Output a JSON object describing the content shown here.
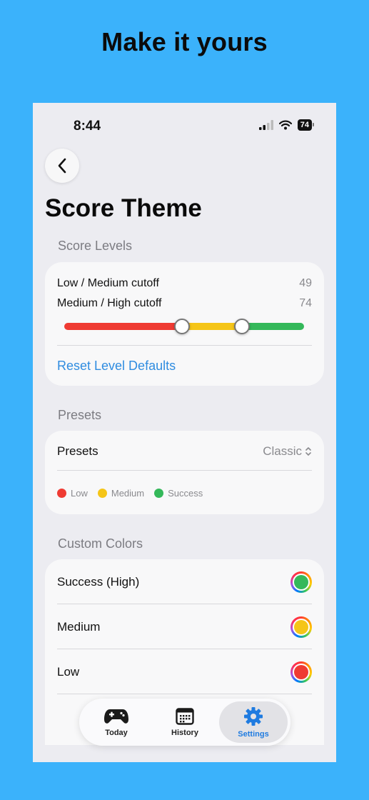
{
  "headline": "Make it yours",
  "status_bar": {
    "time": "8:44",
    "battery": "74"
  },
  "page": {
    "title": "Score Theme"
  },
  "score_levels": {
    "section_label": "Score Levels",
    "low_medium_label": "Low / Medium cutoff",
    "low_medium_value": "49",
    "medium_high_label": "Medium / High cutoff",
    "medium_high_value": "74",
    "slider": {
      "min": 0,
      "max": 100,
      "knob1": 49,
      "knob2": 74
    },
    "reset_label": "Reset Level Defaults"
  },
  "presets": {
    "section_label": "Presets",
    "row_label": "Presets",
    "selected_value": "Classic",
    "legend": [
      {
        "label": "Low",
        "color": "#ef3b33"
      },
      {
        "label": "Medium",
        "color": "#f5c518"
      },
      {
        "label": "Success",
        "color": "#34b85a"
      }
    ]
  },
  "custom_colors": {
    "section_label": "Custom Colors",
    "rows": [
      {
        "label": "Success (High)",
        "color": "#34b85a"
      },
      {
        "label": "Medium",
        "color": "#f5c518"
      },
      {
        "label": "Low",
        "color": "#ef3b33"
      }
    ]
  },
  "tabbar": {
    "tabs": [
      {
        "label": "Today",
        "icon": "gamepad-icon"
      },
      {
        "label": "History",
        "icon": "calendar-icon"
      },
      {
        "label": "Settings",
        "icon": "gear-icon",
        "active": true
      }
    ]
  },
  "colors": {
    "accent": "#1f7be0",
    "background": "#3bb2fb",
    "low": "#ef3b33",
    "medium": "#f5c518",
    "high": "#34b85a"
  }
}
